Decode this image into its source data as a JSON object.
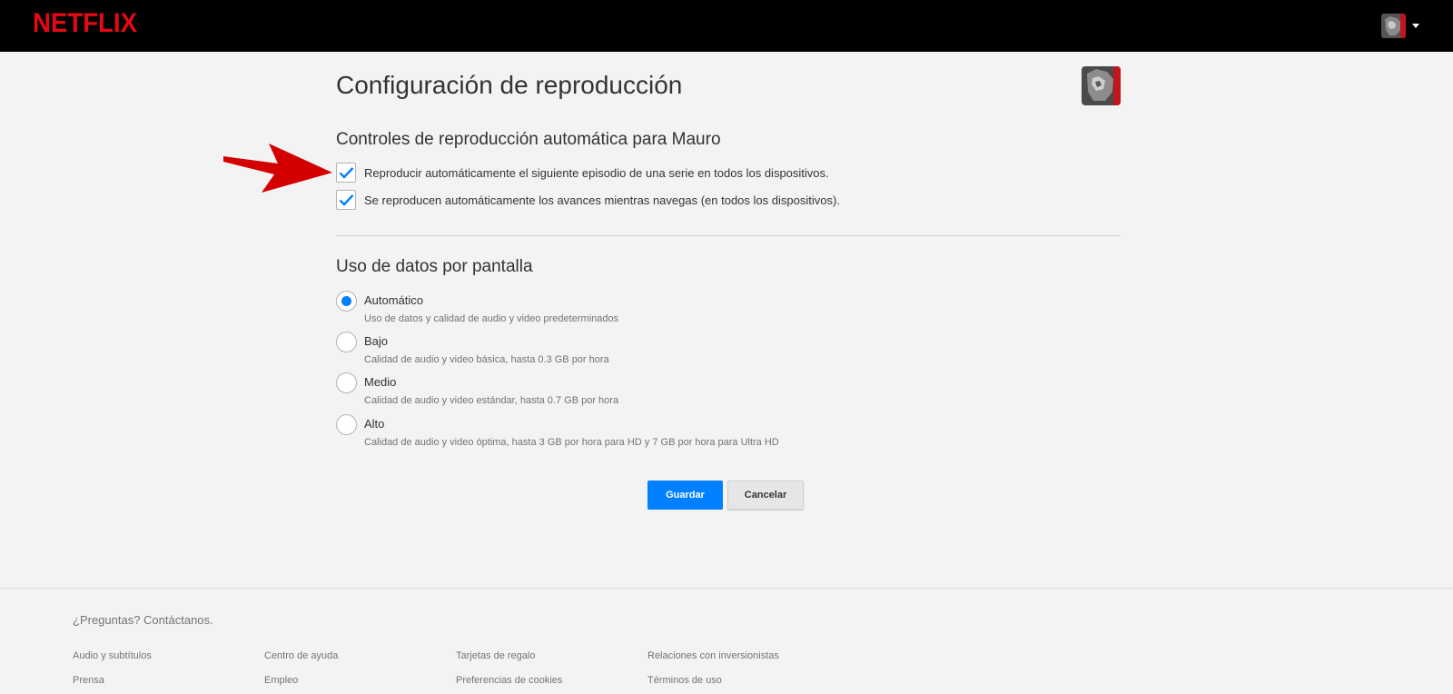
{
  "header": {
    "logo": "NETFLIX",
    "brand_color": "#e50914"
  },
  "main": {
    "title": "Configuración de reproducción",
    "autoplay": {
      "title": "Controles de reproducción automática para Mauro",
      "options": [
        {
          "label": "Reproducir automáticamente el siguiente episodio de una serie en todos los dispositivos.",
          "checked": true
        },
        {
          "label": "Se reproducen automáticamente los avances mientras navegas (en todos los dispositivos).",
          "checked": true
        }
      ]
    },
    "data_usage": {
      "title": "Uso de datos por pantalla",
      "selected": "Automático",
      "options": [
        {
          "label": "Automático",
          "desc": "Uso de datos y calidad de audio y video predeterminados"
        },
        {
          "label": "Bajo",
          "desc": "Calidad de audio y video básica, hasta 0.3 GB por hora"
        },
        {
          "label": "Medio",
          "desc": "Calidad de audio y video estándar, hasta 0.7 GB por hora"
        },
        {
          "label": "Alto",
          "desc": "Calidad de audio y video óptima, hasta 3 GB por hora para HD y 7 GB por hora para Ultra HD"
        }
      ]
    },
    "buttons": {
      "save": "Guardar",
      "cancel": "Cancelar"
    },
    "accent_color": "#0080ff",
    "annotation_arrow_color": "#d40000"
  },
  "footer": {
    "contact": "¿Preguntas? Contáctanos.",
    "links": [
      [
        "Audio y subtítulos",
        "Prensa"
      ],
      [
        "Centro de ayuda",
        "Empleo"
      ],
      [
        "Tarjetas de regalo",
        "Preferencias de cookies"
      ],
      [
        "Relaciones con inversionistas",
        "Términos de uso"
      ]
    ]
  }
}
